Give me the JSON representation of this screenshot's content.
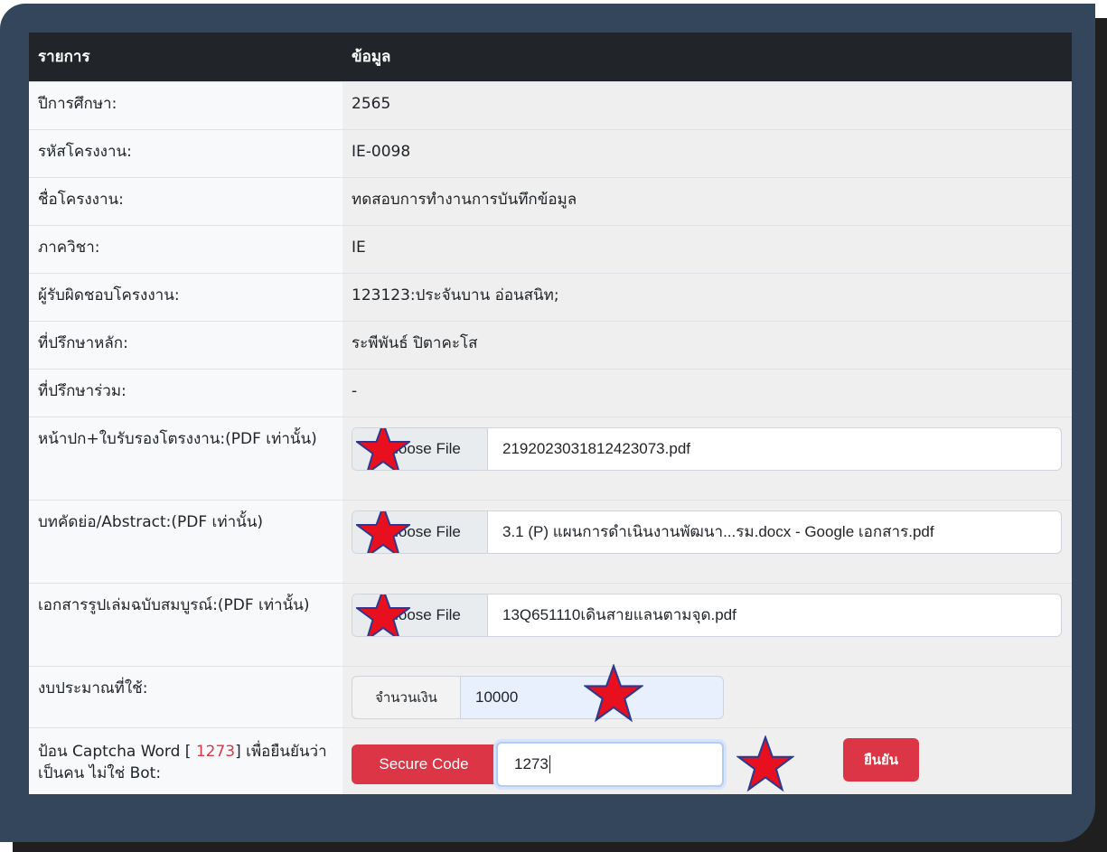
{
  "header": {
    "col_item": "รายการ",
    "col_data": "ข้อมูล"
  },
  "rows": {
    "year": {
      "label": "ปีการศึกษา:",
      "value": "2565"
    },
    "project_code": {
      "label": "รหัสโครงงาน:",
      "value": "IE-0098"
    },
    "project_name": {
      "label": "ชื่อโครงงาน:",
      "value": "ทดสอบการทำงานการบันทึกข้อมูล"
    },
    "department": {
      "label": "ภาควิชา:",
      "value": "IE"
    },
    "owner": {
      "label": "ผู้รับผิดชอบโครงงาน:",
      "value": "123123:ประจันบาน อ่อนสนิท;"
    },
    "main_advisor": {
      "label": "ที่ปรึกษาหลัก:",
      "value": "ระพีพันธ์ ปิตาคะโส"
    },
    "co_advisor": {
      "label": "ที่ปรึกษาร่วม:",
      "value": "-"
    }
  },
  "files": {
    "cover": {
      "label": "หน้าปก+ใบรับรองโตรงงาน:(PDF เท่านั้น)",
      "button": "Choose File",
      "filename": "2192023031812423073.pdf"
    },
    "abstract": {
      "label": "บทคัดย่อ/Abstract:(PDF เท่านั้น)",
      "button": "Choose File",
      "filename": "3.1 (P) แผนการดำเนินงานพัฒนา...รม.docx - Google เอกสาร.pdf"
    },
    "full_report": {
      "label": "เอกสารรูปเล่มฉบับสมบูรณ์:(PDF เท่านั้น)",
      "button": "Choose File",
      "filename": "13Q651110เดินสายแลนตามจุด.pdf"
    }
  },
  "budget": {
    "label": "งบประมาณที่ใช้:",
    "addon": "จำนวนเงิน",
    "value": "10000"
  },
  "captcha": {
    "label_prefix": "ป้อน Captcha Word [ ",
    "code_shown": "1273",
    "label_suffix": "] เพื่อยืนยันว่าเป็นคน ไม่ใช่ Bot:",
    "secure_button": "Secure Code",
    "input_value": "1273",
    "confirm_button": "ยืนยัน"
  },
  "colors": {
    "accent_red": "#dc3545",
    "header_dark": "#212529",
    "frame": "#33465c",
    "star_fill": "#e8101f",
    "star_stroke": "#2b3a8f"
  },
  "icons": {
    "annotation": "red-star-marker"
  }
}
